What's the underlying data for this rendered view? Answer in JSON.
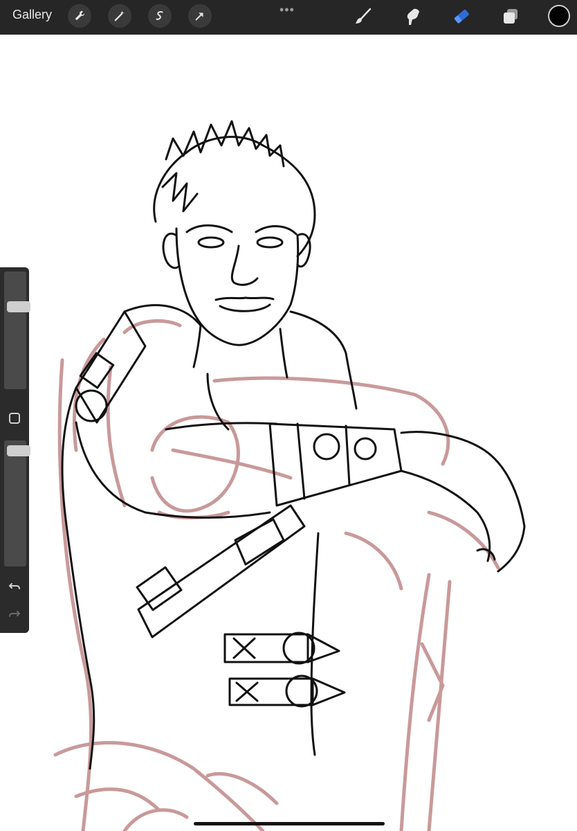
{
  "toolbar": {
    "gallery_label": "Gallery",
    "left_tools": [
      "wrench-icon",
      "magic-wand-icon",
      "selection-icon",
      "transform-arrow-icon"
    ],
    "more_label": "•••",
    "right_tools": [
      "brush-icon",
      "smudge-icon",
      "eraser-icon",
      "layers-icon"
    ],
    "active_tool": "eraser-icon",
    "active_color": "#2f6bd8",
    "current_color": "#000000"
  },
  "sidebar": {
    "brush_size_level": 0.72,
    "opacity_level": 0.96,
    "buttons": [
      "modify-button",
      "undo-icon",
      "redo-icon"
    ]
  },
  "canvas": {
    "sketch_color": "#b87878",
    "ink_color": "#111111"
  }
}
